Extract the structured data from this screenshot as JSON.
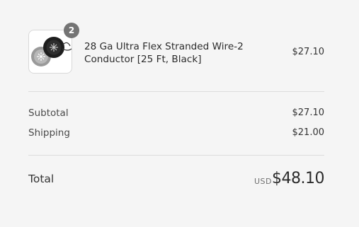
{
  "line_item": {
    "quantity": "2",
    "name": "28 Ga Ultra Flex Stranded Wire-2 Conductor [25 Ft, Black]",
    "price": "$27.10",
    "image_icon": "wire-spool-icon"
  },
  "summary": {
    "subtotal_label": "Subtotal",
    "subtotal_value": "$27.10",
    "shipping_label": "Shipping",
    "shipping_value": "$21.00"
  },
  "total": {
    "label": "Total",
    "currency": "USD",
    "amount": "$48.10"
  },
  "colors": {
    "background": "#f5f5f5",
    "badge": "#747474",
    "divider": "#dcdcdc"
  }
}
